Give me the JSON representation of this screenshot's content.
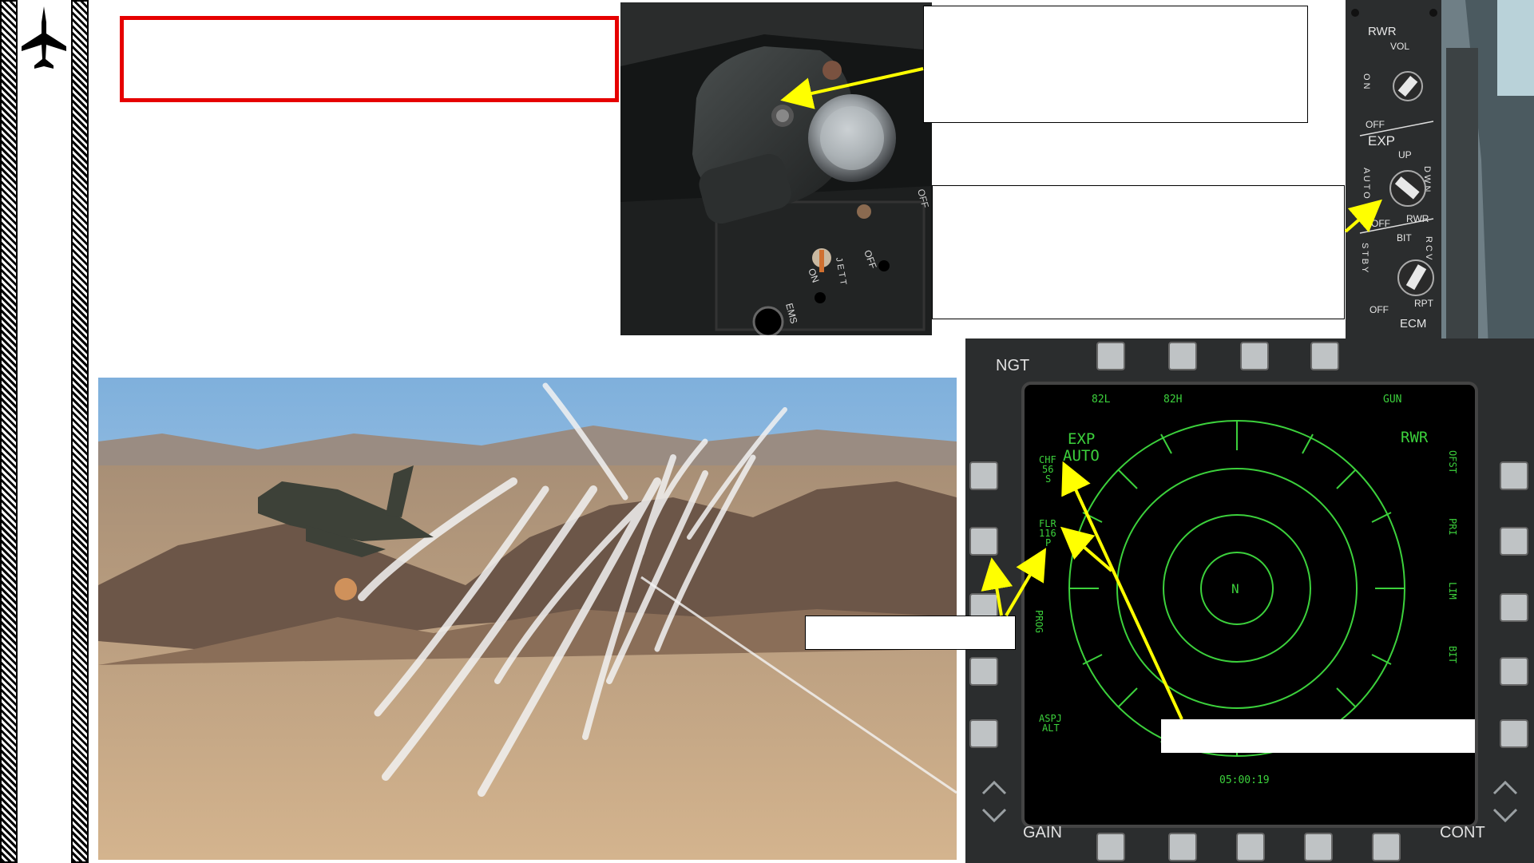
{
  "colors": {
    "title_border": "#e60000",
    "annotation_arrow": "#ffff00",
    "mpcd_symbology": "#3cd13c",
    "bezel": "#2b2d2e"
  },
  "icons": {
    "logo": "harrier-jet-icon"
  },
  "dispenser_panel": {
    "switch_labels": {
      "off": "OFF",
      "jett": "J E T T",
      "on": "ON",
      "ems": "EMS",
      "side_off": "OFF"
    }
  },
  "ecm_panel": {
    "rwr": "RWR",
    "vol": "VOL",
    "on": "O N",
    "off_top": "OFF",
    "exp": "EXP",
    "up": "UP",
    "dwn": "D W N",
    "auto": "A U T O",
    "off_mid": "OFF",
    "rwr_mode": "RWR",
    "bit": "BIT",
    "rcv": "R C V",
    "stby": "S T B Y",
    "rpt": "RPT",
    "off_low": "OFF",
    "ecm": "ECM"
  },
  "mpcd": {
    "ngt": "NGT",
    "gain": "GAIN",
    "cont": "CONT",
    "top_labels": [
      "82L",
      "82H",
      "GUN"
    ],
    "mode": "RWR",
    "exp_line1": "EXP",
    "exp_line2": "AUTO",
    "chf": [
      "CHF",
      "56",
      "S"
    ],
    "flr": [
      "FLR",
      "116",
      "P"
    ],
    "left_labels": [
      "PROG",
      "ASPJ",
      "ALT"
    ],
    "right_labels": [
      "OFST",
      "PRI",
      "LIM",
      "BIT"
    ],
    "center": "N",
    "time": "05:00:19"
  }
}
